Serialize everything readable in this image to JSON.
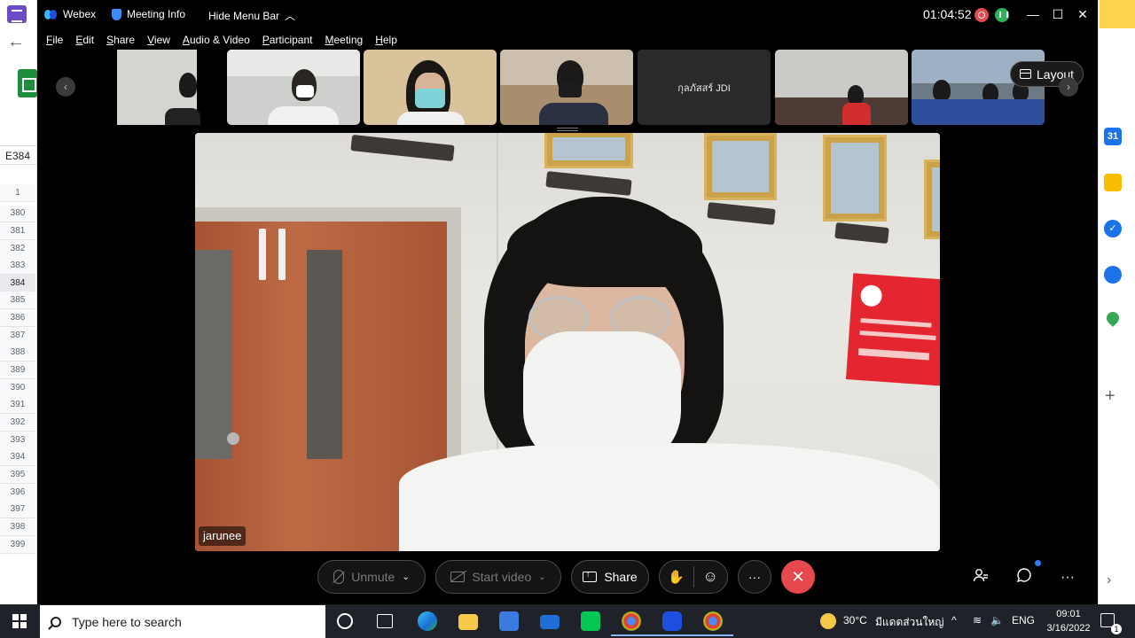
{
  "spreadsheet": {
    "name_box": "E384",
    "rows": [
      "1",
      "380",
      "381",
      "382",
      "383",
      "384",
      "385",
      "386",
      "387",
      "388",
      "389",
      "390",
      "391",
      "392",
      "393",
      "394",
      "395",
      "396",
      "397",
      "398",
      "399"
    ]
  },
  "titlebar": {
    "app_name": "Webex",
    "meeting_info": "Meeting Info",
    "hide_menu": "Hide Menu Bar",
    "timer": "01:04:52",
    "minimize": "—",
    "maximize": "☐",
    "close": "✕"
  },
  "menu": {
    "items": [
      {
        "first": "F",
        "rest": "ile"
      },
      {
        "first": "E",
        "rest": "dit"
      },
      {
        "first": "S",
        "rest": "hare"
      },
      {
        "first": "V",
        "rest": "iew"
      },
      {
        "first": "A",
        "rest": "udio & Video"
      },
      {
        "first": "P",
        "rest": "articipant"
      },
      {
        "first": "M",
        "rest": "eeting"
      },
      {
        "first": "H",
        "rest": "elp"
      }
    ]
  },
  "thumbnails": {
    "prev": "‹",
    "next": "›",
    "labeled": "กุลภัสสร์ JDI",
    "layout_label": "Layout"
  },
  "main_video": {
    "participant_name": "jarunee"
  },
  "controls": {
    "unmute": "Unmute",
    "start_video": "Start video",
    "share": "Share",
    "raise_hand": "✋",
    "reactions": "☺",
    "more": "···",
    "end": "✕",
    "participants": "👤",
    "chat": "💬",
    "more_right": "···",
    "caret": "⌄"
  },
  "taskbar": {
    "search_placeholder": "Type here to search",
    "weather_temp": "30°C",
    "weather_text": "มีแดดส่วนใหญ่",
    "tray_chevron": "^",
    "language": "ENG",
    "time": "09:01",
    "date": "3/16/2022",
    "notif_count": "1"
  },
  "colors": {
    "accent_end": "#e5484d",
    "webex_bg": "#000000",
    "taskbar_bg": "#1f2228"
  }
}
